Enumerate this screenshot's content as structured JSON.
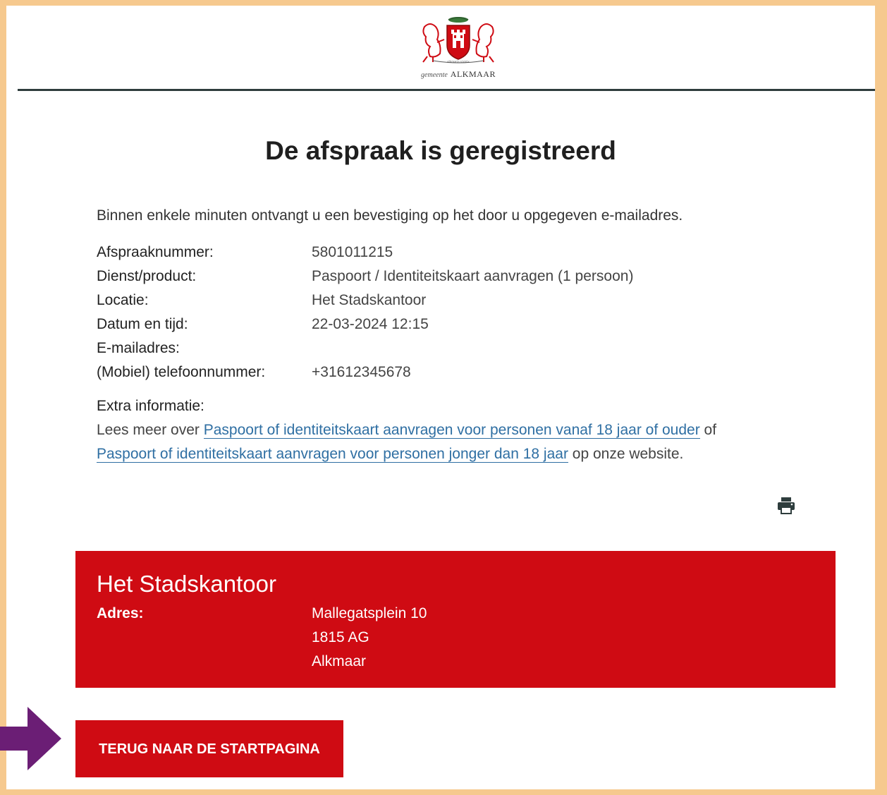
{
  "header": {
    "logo": {
      "small_text": "alkmaria victrix",
      "italic_text": "gemeente",
      "caps_text": "ALKMAAR"
    }
  },
  "main": {
    "title": "De afspraak is geregistreerd",
    "intro": "Binnen enkele minuten ontvangt u een bevestiging op het door u opgegeven e-mailadres.",
    "details": [
      {
        "label": "Afspraaknummer:",
        "value": "5801011215"
      },
      {
        "label": "Dienst/product:",
        "value": "Paspoort / Identiteitskaart aanvragen (1 persoon)"
      },
      {
        "label": "Locatie:",
        "value": "Het Stadskantoor"
      },
      {
        "label": "Datum en tijd:",
        "value": "22-03-2024 12:15"
      },
      {
        "label": "E-mailadres:",
        "value": ""
      },
      {
        "label": "(Mobiel) telefoonnummer:",
        "value": "+31612345678"
      }
    ],
    "extra": {
      "title": "Extra informatie:",
      "text_before": "Lees meer over ",
      "link1": "Paspoort of identiteitskaart aanvragen voor personen vanaf 18 jaar of ouder",
      "text_middle": " of ",
      "link2": "Paspoort of identiteitskaart aanvragen voor personen jonger dan 18 jaar",
      "text_after": " op onze website."
    },
    "print_icon": "printer-icon"
  },
  "location": {
    "name": "Het Stadskantoor",
    "address_label": "Adres:",
    "address_lines": [
      "Mallegatsplein 10",
      "1815 AG",
      "Alkmaar"
    ]
  },
  "back_button": {
    "label": "TERUG NAAR DE STARTPAGINA"
  },
  "annotation": {
    "arrow_icon": "arrow-right-icon",
    "arrow_color": "#6b1e75"
  },
  "colors": {
    "accent_red": "#cf0b13",
    "link_blue": "#2f6fa3",
    "frame": "#f6c98e"
  }
}
